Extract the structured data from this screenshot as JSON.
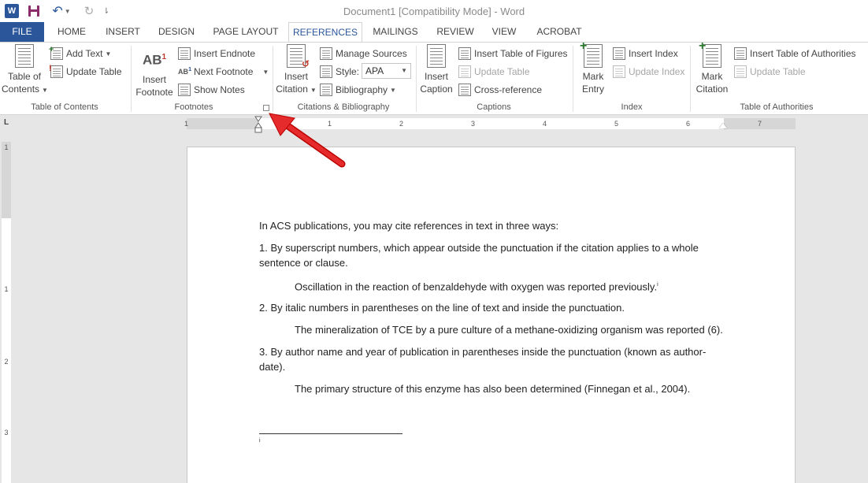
{
  "titlebar": {
    "title": "Document1 [Compatibility Mode] - Word",
    "word_icon": "W",
    "save_icon": "save-icon",
    "undo_icon": "↶",
    "redo_icon": "↻",
    "customize_icon": "⇂"
  },
  "tabs": {
    "file": "FILE",
    "home": "HOME",
    "insert": "INSERT",
    "design": "DESIGN",
    "page_layout": "PAGE LAYOUT",
    "references": "REFERENCES",
    "mailings": "MAILINGS",
    "review": "REVIEW",
    "view": "VIEW",
    "acrobat": "ACROBAT"
  },
  "ribbon": {
    "toc": {
      "table_of_contents_1": "Table of",
      "table_of_contents_2": "Contents",
      "add_text": "Add Text",
      "update_table": "Update Table",
      "group": "Table of Contents"
    },
    "footnotes": {
      "insert_footnote_1": "Insert",
      "insert_footnote_2": "Footnote",
      "footnote_icon": "AB",
      "footnote_sup": "1",
      "insert_endnote": "Insert Endnote",
      "next_footnote": "Next Footnote",
      "show_notes": "Show Notes",
      "group": "Footnotes"
    },
    "citations": {
      "insert_citation_1": "Insert",
      "insert_citation_2": "Citation",
      "manage_sources": "Manage Sources",
      "style_label": "Style:",
      "style_value": "APA",
      "bibliography": "Bibliography",
      "group": "Citations & Bibliography"
    },
    "captions": {
      "insert_caption_1": "Insert",
      "insert_caption_2": "Caption",
      "insert_table_of_figures": "Insert Table of Figures",
      "update_table": "Update Table",
      "cross_reference": "Cross-reference",
      "group": "Captions"
    },
    "index": {
      "mark_entry_1": "Mark",
      "mark_entry_2": "Entry",
      "insert_index": "Insert Index",
      "update_index": "Update Index",
      "group": "Index"
    },
    "authorities": {
      "mark_citation_1": "Mark",
      "mark_citation_2": "Citation",
      "insert_table_of_authorities": "Insert Table of Authorities",
      "update_table": "Update Table",
      "group": "Table of Authorities"
    }
  },
  "ruler": {
    "corner": "L",
    "h_numbers": [
      "1",
      "1",
      "2",
      "3",
      "4",
      "5",
      "6",
      "7"
    ],
    "v_numbers": [
      "1",
      "1",
      "2",
      "3"
    ]
  },
  "document": {
    "p1": "In ACS publications, you may cite references in text in three ways:",
    "p2_line1": "1. By superscript numbers, which appear outside the punctuation if the citation applies to a whole",
    "p2_line2": "sentence or clause.",
    "p3": "Oscillation in the reaction of benzaldehyde with oxygen was reported previously.",
    "p3_sup": "i",
    "p4": "2. By italic numbers in parentheses on the line of text and inside the punctuation.",
    "p5": "The mineralization of TCE by a pure culture of a methane-oxidizing organism was reported (6).",
    "p6_line1": "3. By author name and year of publication in parentheses inside the punctuation (known as author-",
    "p6_line2": "date).",
    "p7": "The primary structure of this enzyme has also been determined (Finnegan et al., 2004).",
    "footnote_marker": "i"
  }
}
